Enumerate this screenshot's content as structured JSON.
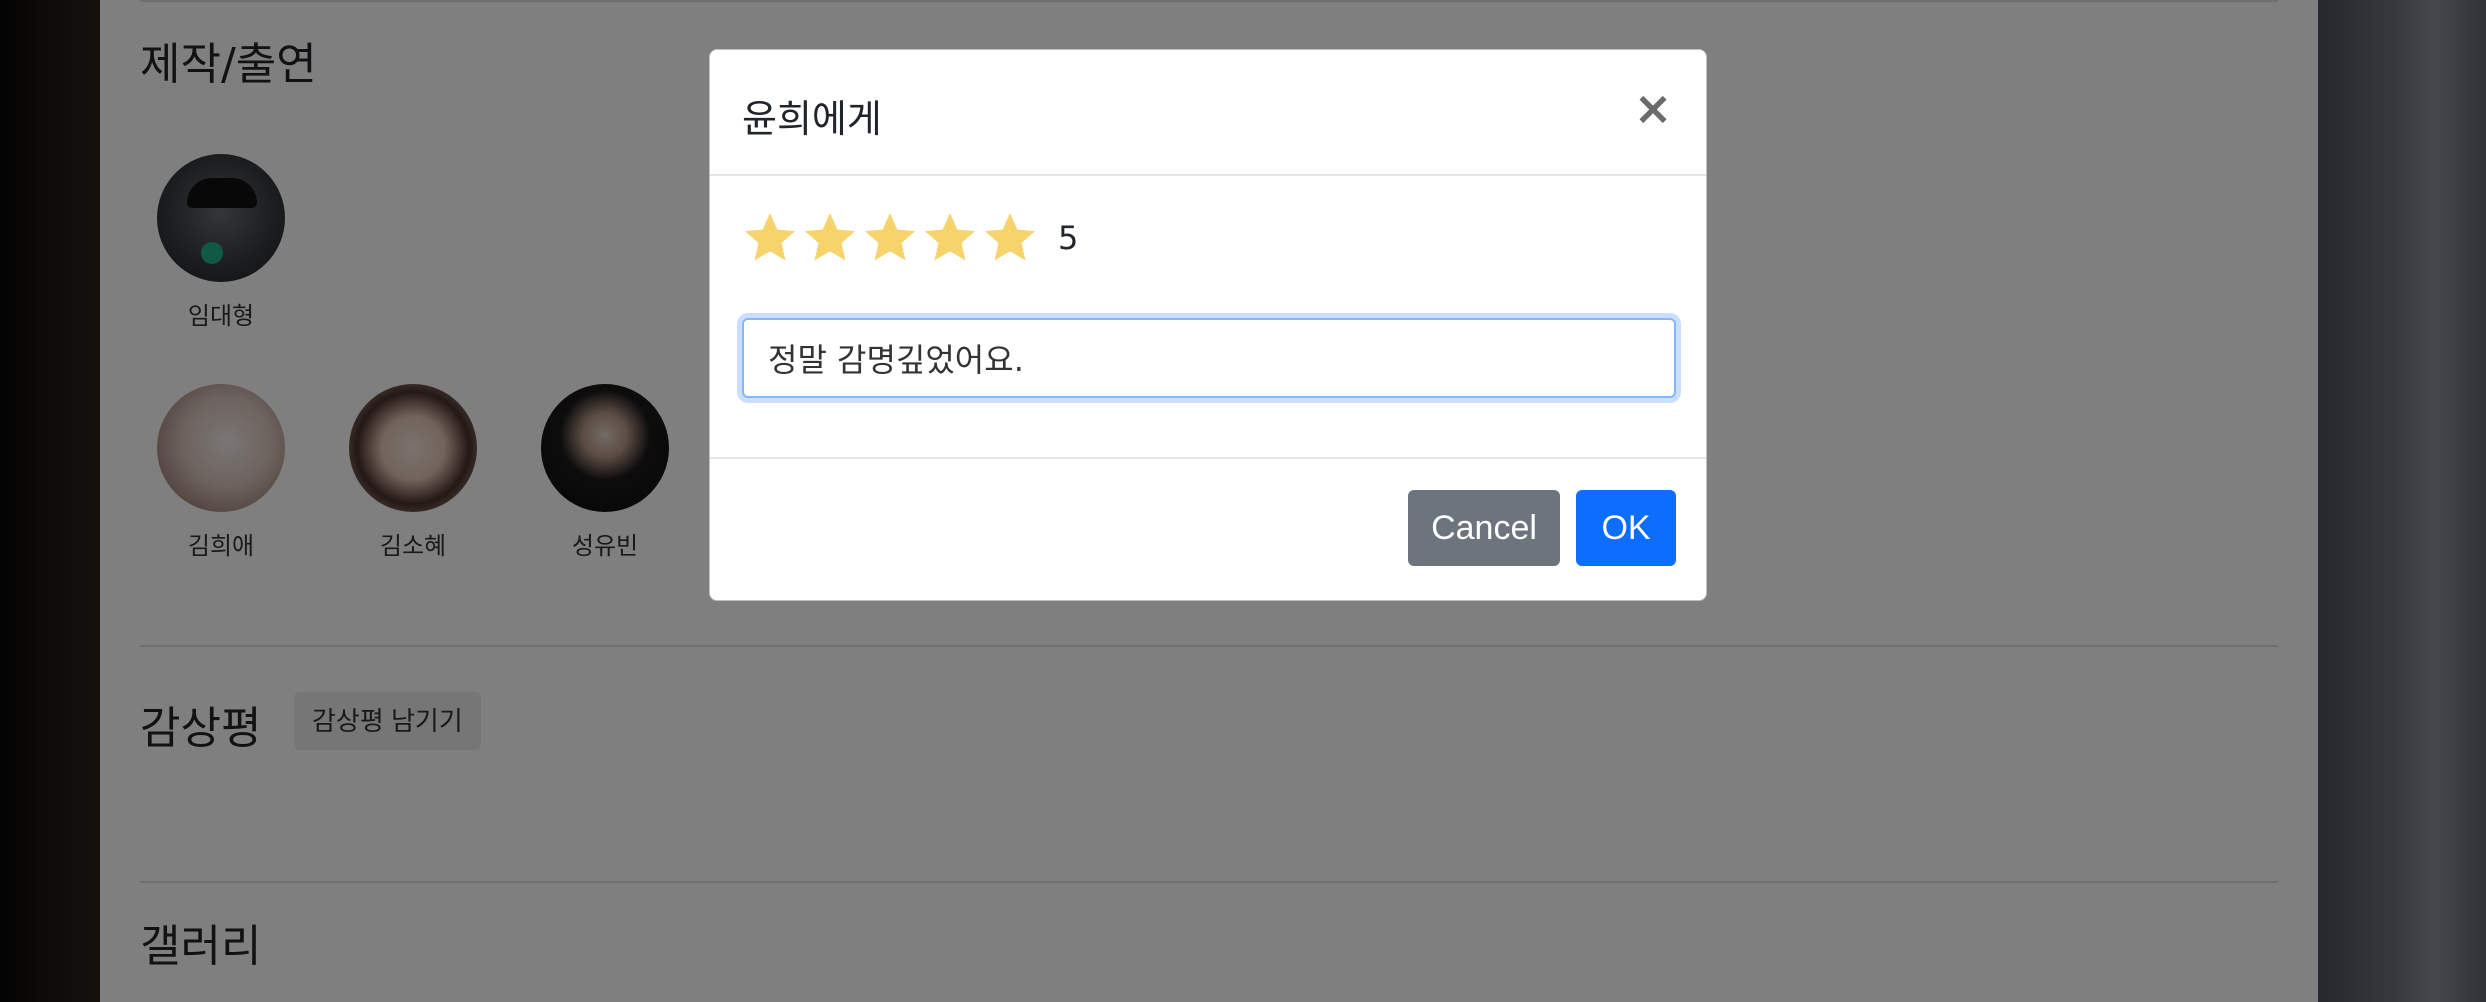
{
  "page": {
    "cast_section_title": "제작/출연",
    "review_section_title": "감상평",
    "review_button_label": "감상평 남기기",
    "gallery_section_title": "갤러리",
    "people": [
      {
        "name": "임대형"
      },
      {
        "name": "김희애"
      },
      {
        "name": "김소혜"
      },
      {
        "name": "성유빈"
      }
    ]
  },
  "modal": {
    "title": "윤희에게",
    "close_icon": "close-icon",
    "rating": 5,
    "rating_label": "5",
    "star_color": "#f7d36b",
    "comment_value": "정말 감명깊었어요.",
    "cancel_label": "Cancel",
    "ok_label": "OK"
  }
}
